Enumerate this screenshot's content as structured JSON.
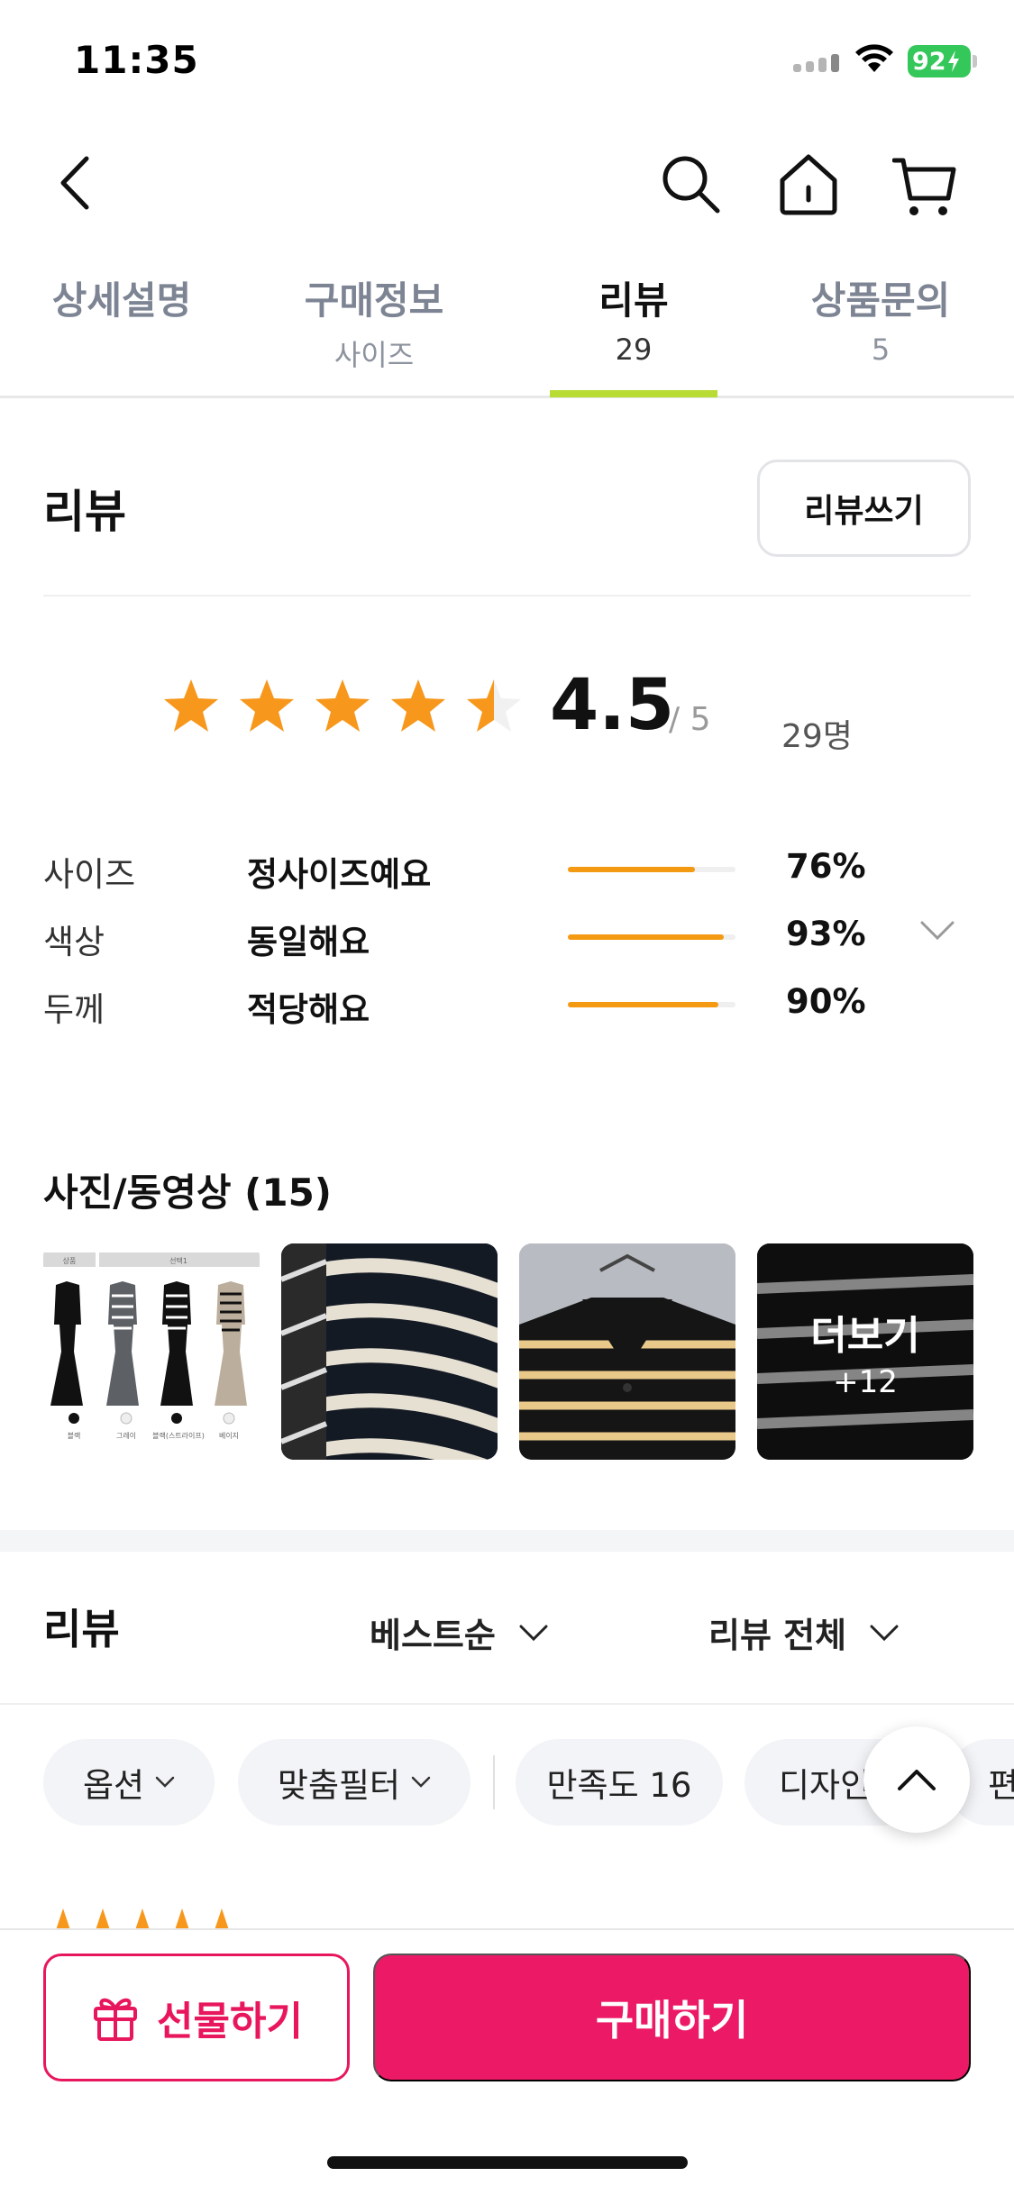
{
  "status_bar": {
    "time": "11:35",
    "battery": "92"
  },
  "nav": {
    "back": "back-arrow-icon",
    "search": "search-icon",
    "home": "home-icon",
    "cart": "cart-icon"
  },
  "tabs": [
    {
      "label": "상세설명",
      "sub": ""
    },
    {
      "label": "구매정보",
      "sub": "사이즈"
    },
    {
      "label": "리뷰",
      "sub": "29"
    },
    {
      "label": "상품문의",
      "sub": "5"
    }
  ],
  "active_tab": 2,
  "review_section": {
    "title": "리뷰",
    "write_button": "리뷰쓰기"
  },
  "rating": {
    "score": "4.5",
    "max": "/ 5",
    "count": "29명",
    "stars_value": 4.5,
    "star_color": "#f7981d"
  },
  "attributes": [
    {
      "name": "사이즈",
      "value": "정사이즈예요",
      "percent": 76,
      "percent_label": "76%"
    },
    {
      "name": "색상",
      "value": "동일해요",
      "percent": 93,
      "percent_label": "93%"
    },
    {
      "name": "두께",
      "value": "적당해요",
      "percent": 90,
      "percent_label": "90%"
    }
  ],
  "photos": {
    "title": "사진/동영상 (15)",
    "more_label": "더보기",
    "more_count": "+12",
    "thumb1_captions": [
      "블랙",
      "그레이",
      "블랙(스트라이프)",
      "베이지"
    ],
    "thumb1_header": [
      "상품",
      "선택1"
    ]
  },
  "review_list": {
    "title": "리뷰",
    "sort": "베스트순",
    "filter": "리뷰 전체"
  },
  "chips": [
    "옵션",
    "맞춤필터",
    "만족도 16",
    "디자인",
    "편"
  ],
  "bottom": {
    "gift": "선물하기",
    "buy": "구매하기",
    "accent": "#ec1a66"
  }
}
